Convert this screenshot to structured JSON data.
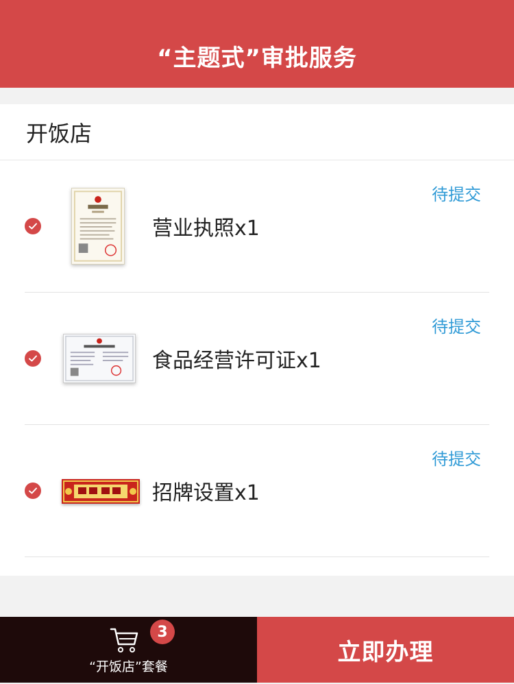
{
  "header": {
    "title": "“主题式”审批服务"
  },
  "section": {
    "title": "开饭店"
  },
  "items": [
    {
      "label": "营业执照x1",
      "status": "待提交",
      "icon": "business-license-thumb"
    },
    {
      "label": "食品经营许可证x1",
      "status": "待提交",
      "icon": "food-permit-thumb"
    },
    {
      "label": "招牌设置x1",
      "status": "待提交",
      "icon": "signboard-thumb"
    }
  ],
  "cart": {
    "count": "3",
    "label": "“开饭店”套餐",
    "icon": "cart-icon"
  },
  "actions": {
    "submit_label": "立即办理"
  },
  "colors": {
    "accent": "#d44848",
    "status": "#2f9ad6",
    "cart_bg": "#1e0a0a"
  }
}
